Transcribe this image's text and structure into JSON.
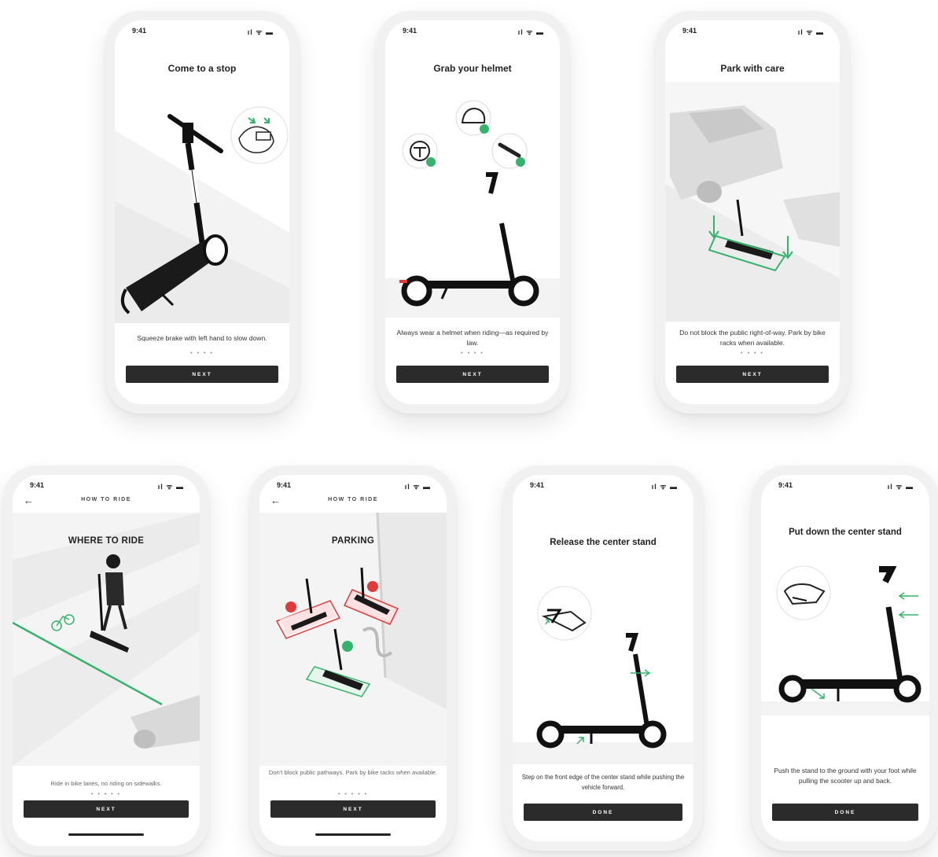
{
  "status": {
    "time": "9:41",
    "icons": "ıl ᯤ ▬"
  },
  "accent": "#33b36b",
  "danger": "#e23a3a",
  "screens": [
    {
      "title": "Come to a stop",
      "caption": "Squeeze brake with left hand to slow down.",
      "dots": "• • • •",
      "button": "NEXT",
      "illustration": "scooter-brake"
    },
    {
      "title": "Grab your helmet",
      "caption": "Always wear a helmet when riding—as required by law.",
      "dots": "• • • •",
      "button": "NEXT",
      "illustration": "scooter-helmet"
    },
    {
      "title": "Park with care",
      "caption": "Do not block the public right-of-way. Park by bike racks when available.",
      "dots": "• • • •",
      "button": "NEXT",
      "illustration": "scooter-parking-car"
    },
    {
      "nav_title": "HOW TO RIDE",
      "title": "WHERE TO RIDE",
      "caption": "Ride in bike lanes, no riding on sidewalks.",
      "dots": "• • • • •",
      "button": "NEXT",
      "illustration": "rider-bike-lane"
    },
    {
      "nav_title": "HOW TO RIDE",
      "title": "PARKING",
      "caption": "Don't block public pathways. Park by bike racks when available.",
      "dots": "• • • • •",
      "button": "NEXT",
      "illustration": "parking-zones"
    },
    {
      "title": "Release the center stand",
      "caption": "Step on the front edge of the center stand while pushing the vehicle forward.",
      "button": "DONE",
      "illustration": "stand-release"
    },
    {
      "title": "Put down the center stand",
      "caption": "Push the stand to the ground with your foot while pulling the scooter up and back.",
      "button": "DONE",
      "illustration": "stand-down"
    }
  ]
}
